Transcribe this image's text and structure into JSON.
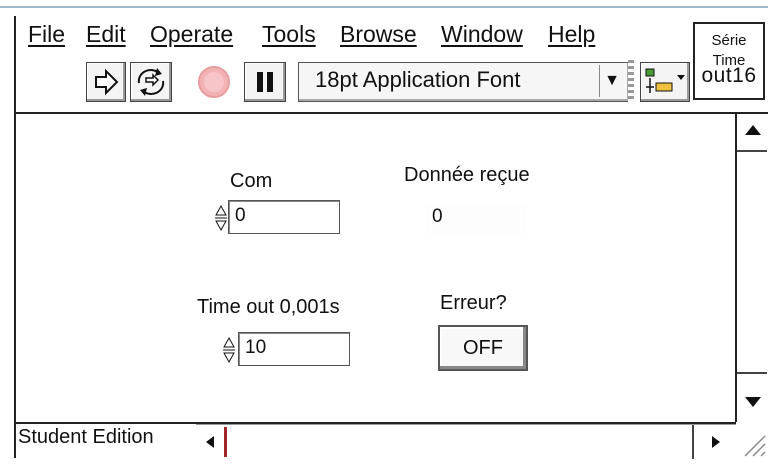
{
  "menu": {
    "items": [
      {
        "label": "File"
      },
      {
        "label": "Edit"
      },
      {
        "label": "Operate"
      },
      {
        "label": "Tools"
      },
      {
        "label": "Browse"
      },
      {
        "label": "Window"
      },
      {
        "label": "Help"
      }
    ]
  },
  "toolbar": {
    "font_selector": "18pt Application Font",
    "dropdown_arrow": "▼"
  },
  "connector": {
    "line1": "Série",
    "line2": "Time",
    "line3": "out16"
  },
  "controls": {
    "com": {
      "label": "Com",
      "value": "0"
    },
    "donnee": {
      "label": "Donnée reçue",
      "value": "0"
    },
    "timeout": {
      "label": "Time out 0,001s",
      "value": "10"
    },
    "erreur": {
      "label": "Erreur?",
      "button": "OFF"
    }
  },
  "status": {
    "edition": "Student Edition"
  },
  "colors": {
    "run_stop_button": "#f3b2b4",
    "frame": "#222222"
  }
}
